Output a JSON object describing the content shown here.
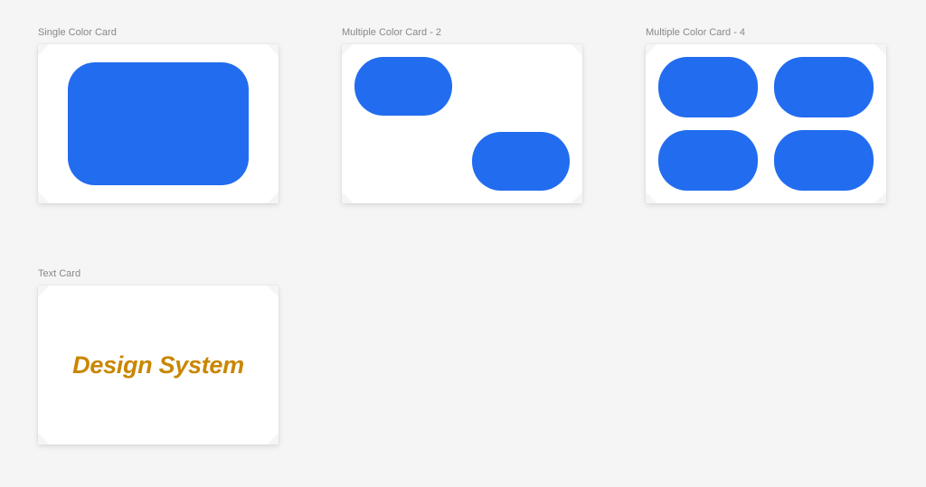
{
  "cards": {
    "single": {
      "label": "Single Color Card",
      "swatch_color": "#226cef"
    },
    "multi2": {
      "label": "Multiple Color Card - 2",
      "swatch_color": "#226cef"
    },
    "multi4": {
      "label": "Multiple Color Card - 4",
      "swatch_color": "#226cef"
    },
    "text": {
      "label": "Text Card",
      "text": "Design System",
      "text_color": "#c98700"
    }
  }
}
